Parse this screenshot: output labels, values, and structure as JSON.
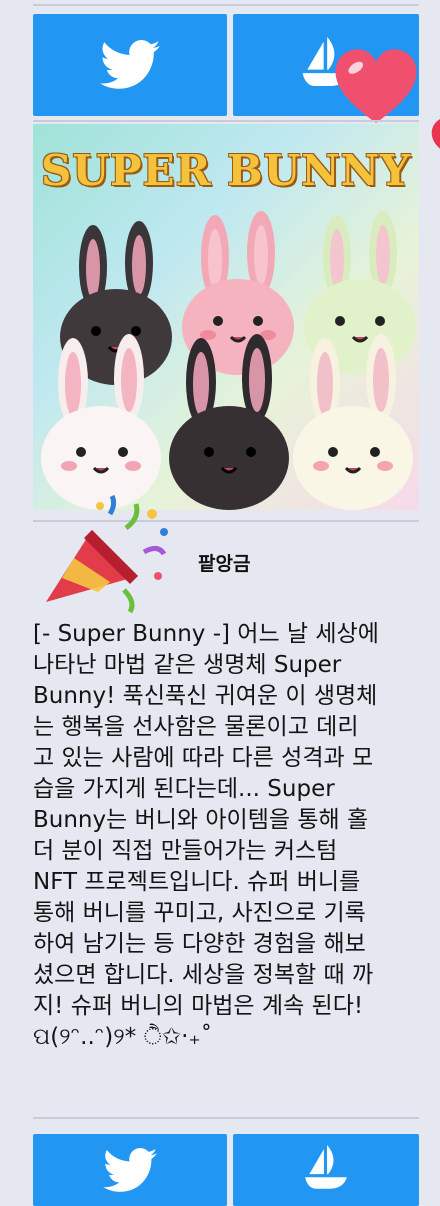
{
  "links": {
    "twitter_icon": "twitter-icon",
    "opensea_icon": "opensea-icon",
    "accent_color": "#2196f3"
  },
  "nft": {
    "artwork_title": "SUPER BUNNY",
    "decor_icons": [
      "heart-icon",
      "party-popper-icon"
    ]
  },
  "author": {
    "name": "팥앙금"
  },
  "description": "[- Super Bunny -] 어느 날 세상에\n나타난 마법 같은 생명체 Super\nBunny! 푹신푹신 귀여운 이 생명체\n는 행복을 선사함은 물론이고 데리\n고 있는 사람에 따라 다른 성격과 모\n습을 가지게 된다는데... Super\nBunny는 버니와 아이템을 통해 홀\n더 분이 직접 만들어가는 커스텀\nNFT 프로젝트입니다. 슈퍼 버니를\n통해 버니를 꾸미고, 사진으로 기록\n하여 남기는 등 다양한 경험을 해보\n셨으면 합니다. 세상을 정복할 때 까\n지! 슈퍼 버니의 마법은 계속 된다!\nପ(୨ᵔ..ᵔ)୨* ੈ✩‧₊˚"
}
